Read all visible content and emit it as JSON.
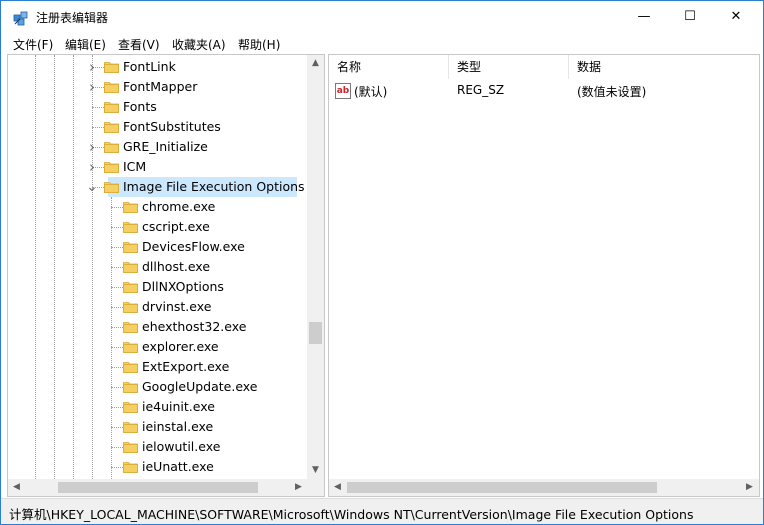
{
  "window": {
    "title": "注册表编辑器",
    "minimize": "—",
    "maximize": "☐",
    "close": "✕"
  },
  "menu": [
    {
      "label": "文件(F)"
    },
    {
      "label": "编辑(E)"
    },
    {
      "label": "查看(V)"
    },
    {
      "label": "收藏夹(A)"
    },
    {
      "label": "帮助(H)"
    }
  ],
  "tree": {
    "parents": [
      {
        "label": "FontLink",
        "expander": "collapsed"
      },
      {
        "label": "FontMapper",
        "expander": "collapsed"
      },
      {
        "label": "Fonts",
        "expander": "none"
      },
      {
        "label": "FontSubstitutes",
        "expander": "none"
      },
      {
        "label": "GRE_Initialize",
        "expander": "collapsed"
      },
      {
        "label": "ICM",
        "expander": "collapsed"
      },
      {
        "label": "Image File Execution Options",
        "expander": "expanded",
        "selected": true
      }
    ],
    "children": [
      {
        "label": "chrome.exe"
      },
      {
        "label": "cscript.exe"
      },
      {
        "label": "DevicesFlow.exe"
      },
      {
        "label": "dllhost.exe"
      },
      {
        "label": "DllNXOptions"
      },
      {
        "label": "drvinst.exe"
      },
      {
        "label": "ehexthost32.exe"
      },
      {
        "label": "explorer.exe"
      },
      {
        "label": "ExtExport.exe"
      },
      {
        "label": "GoogleUpdate.exe"
      },
      {
        "label": "ie4uinit.exe"
      },
      {
        "label": "ieinstal.exe"
      },
      {
        "label": "ielowutil.exe"
      },
      {
        "label": "ieUnatt.exe"
      }
    ]
  },
  "list": {
    "columns": [
      "名称",
      "类型",
      "数据"
    ],
    "rows": [
      {
        "icon": "ab",
        "name": "(默认)",
        "type": "REG_SZ",
        "data": "(数值未设置)"
      }
    ]
  },
  "status": {
    "path": "计算机\\HKEY_LOCAL_MACHINE\\SOFTWARE\\Microsoft\\Windows NT\\CurrentVersion\\Image File Execution Options"
  },
  "colors": {
    "selection": "#cce8ff",
    "folder": "#f5cf62",
    "window_border": "#2b7fd0"
  }
}
